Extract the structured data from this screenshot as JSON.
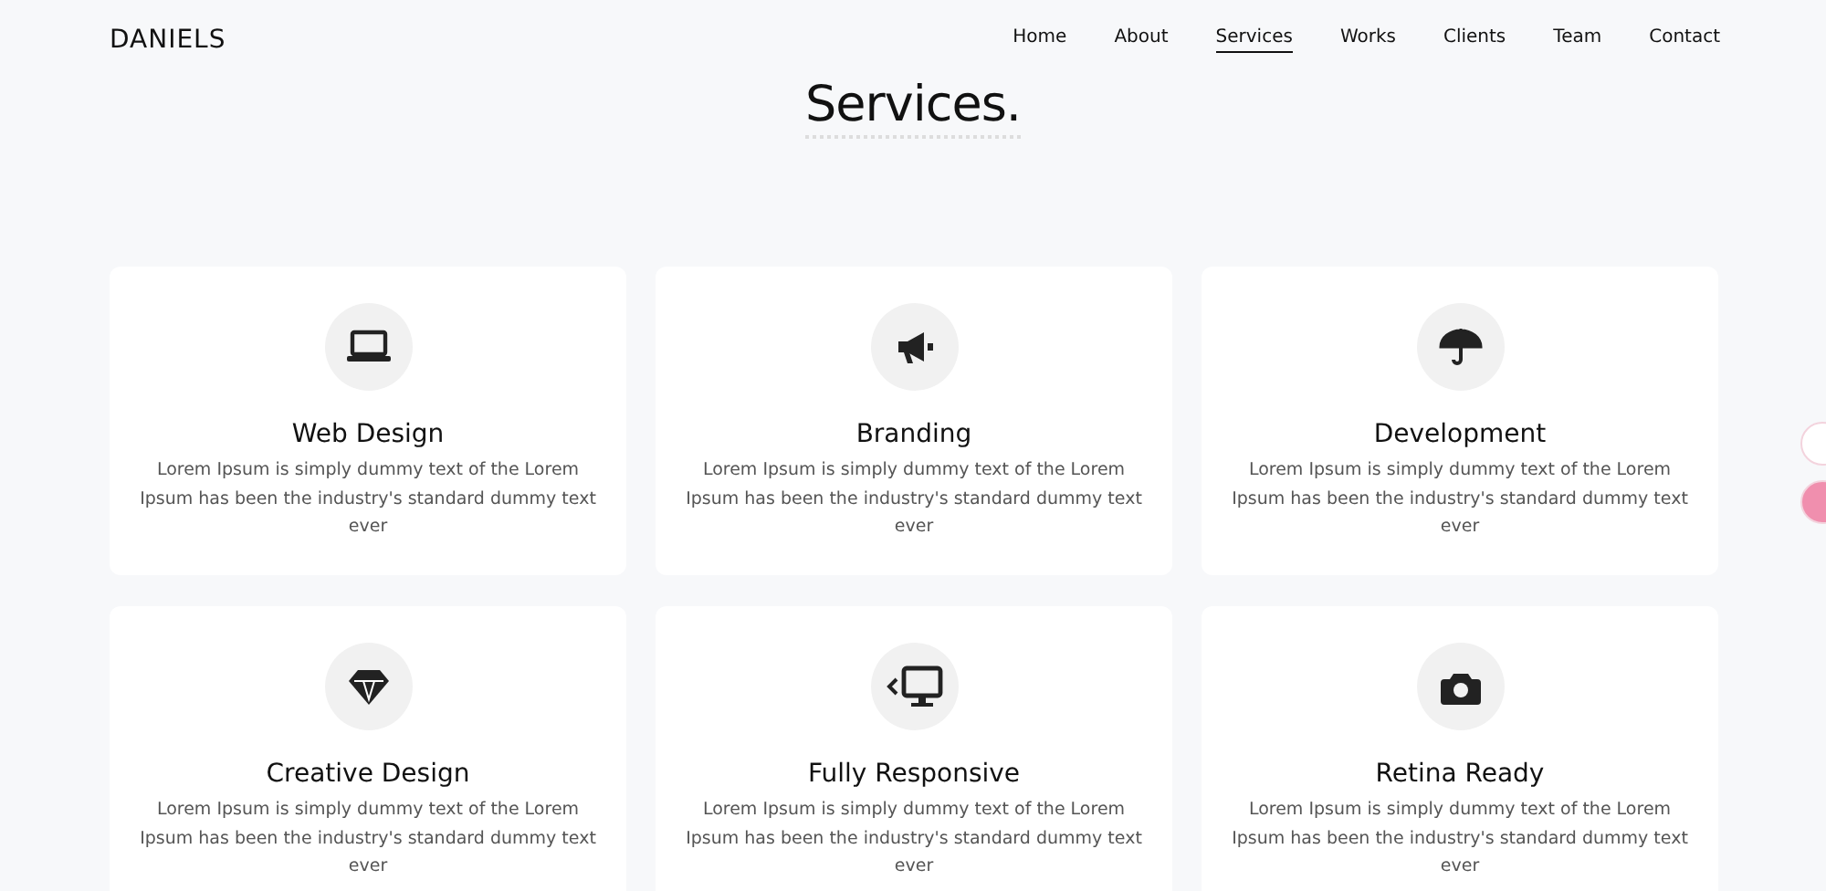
{
  "header": {
    "logo": "DANIELS",
    "nav": [
      {
        "label": "Home",
        "selected": false
      },
      {
        "label": "About",
        "selected": false
      },
      {
        "label": "Services",
        "selected": true
      },
      {
        "label": "Works",
        "selected": false
      },
      {
        "label": "Clients",
        "selected": false
      },
      {
        "label": "Team",
        "selected": false
      },
      {
        "label": "Contact",
        "selected": false
      }
    ]
  },
  "section": {
    "title": "Services.",
    "cards": [
      {
        "title": "Web Design",
        "text": "Lorem Ipsum is simply dummy text of the Lorem Ipsum has been the industry's standard dummy text ever"
      },
      {
        "title": "Branding",
        "text": "Lorem Ipsum is simply dummy text of the Lorem Ipsum has been the industry's standard dummy text ever"
      },
      {
        "title": "Development",
        "text": "Lorem Ipsum is simply dummy text of the Lorem Ipsum has been the industry's standard dummy text ever"
      },
      {
        "title": "Creative Design",
        "text": "Lorem Ipsum is simply dummy text of the Lorem Ipsum has been the industry's standard dummy text ever"
      },
      {
        "title": "Fully Responsive",
        "text": "Lorem Ipsum is simply dummy text of the Lorem Ipsum has been the industry's standard dummy text ever"
      },
      {
        "title": "Retina Ready",
        "text": "Lorem Ipsum is simply dummy text of the Lorem Ipsum has been the industry's standard dummy text ever"
      }
    ]
  }
}
